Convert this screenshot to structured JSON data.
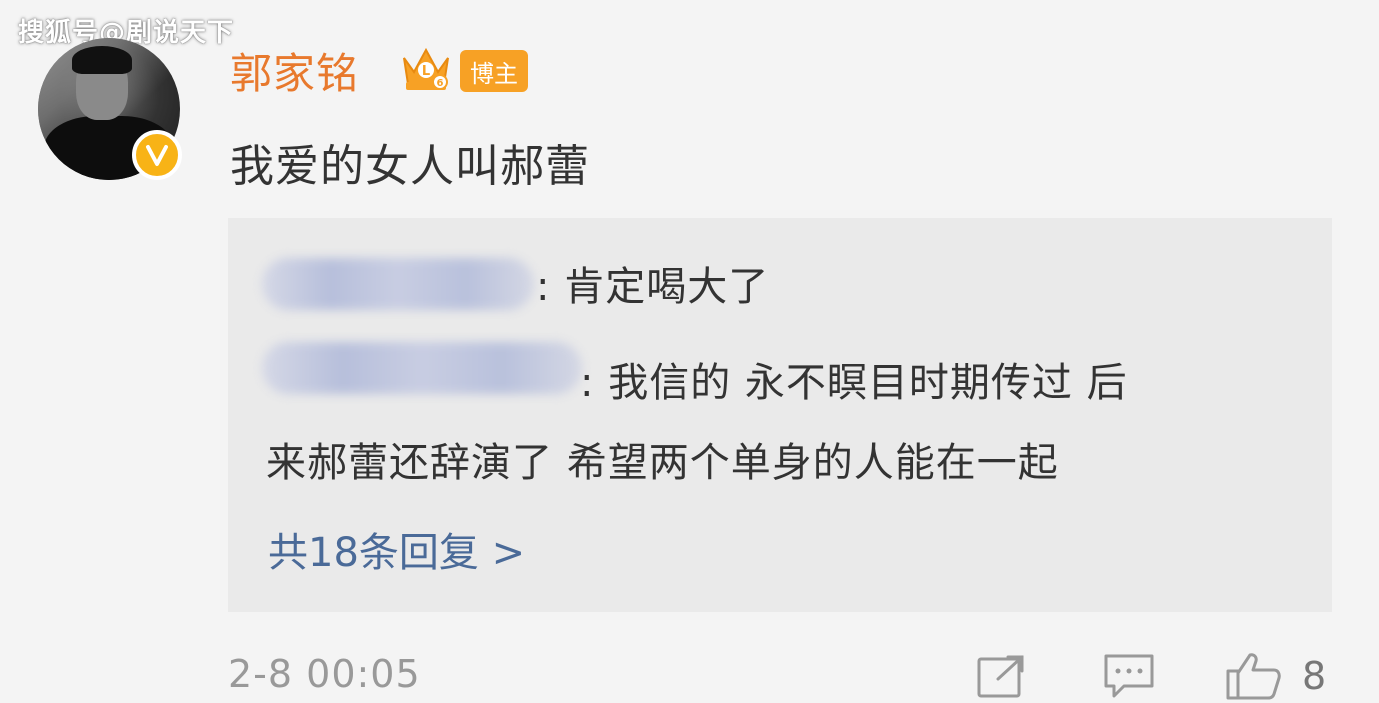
{
  "watermark": "搜狐号@剧说天下",
  "post": {
    "username": "郭家铭",
    "badge": "博主",
    "text": "我爱的女人叫郝蕾",
    "timestamp": "2-8 00:05",
    "like_count": "8"
  },
  "replies": [
    {
      "text": ": 肯定喝大了"
    },
    {
      "text_line1": ": 我信的 永不瞑目时期传过 后",
      "text_line2": "来郝蕾还辞演了 希望两个单身的人能在一起"
    }
  ],
  "more_replies": "共18条回复 >",
  "colors": {
    "username": "#e8792d",
    "badge": "#f7a125",
    "verified": "#f8b316",
    "link": "#4a6a98"
  },
  "icons": [
    "verified-v-icon",
    "crown-level-icon",
    "share-icon",
    "comment-icon",
    "like-thumb-icon"
  ]
}
